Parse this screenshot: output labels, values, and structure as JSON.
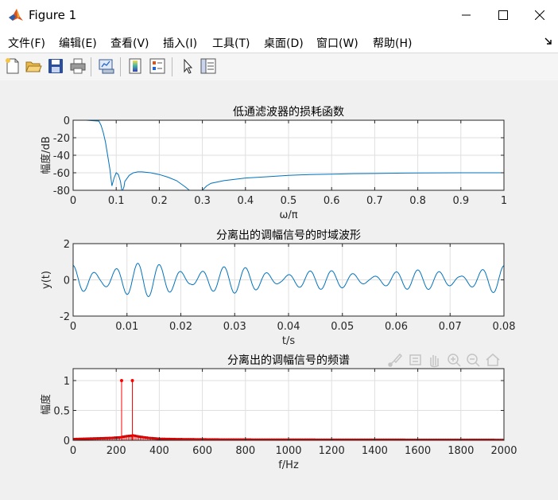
{
  "window": {
    "title": "Figure 1"
  },
  "menu": [
    {
      "label": "文件(F)"
    },
    {
      "label": "编辑(E)"
    },
    {
      "label": "查看(V)"
    },
    {
      "label": "插入(I)"
    },
    {
      "label": "工具(T)"
    },
    {
      "label": "桌面(D)"
    },
    {
      "label": "窗口(W)"
    },
    {
      "label": "帮助(H)"
    }
  ],
  "toolbar_icons": [
    "new-figure-icon",
    "open-file-icon",
    "save-icon",
    "print-icon",
    "link-plot-icon",
    "insert-colorbar-icon",
    "insert-legend-icon",
    "pointer-icon",
    "property-inspector-icon"
  ],
  "colors": {
    "line": "#0072bd",
    "stem": "#ff0000",
    "marker": "#a00000"
  },
  "chart_data": [
    {
      "type": "line",
      "title": "低通滤波器的损耗函数",
      "xlabel": "ω/π",
      "ylabel": "幅度/dB",
      "xlim": [
        0,
        1
      ],
      "ylim": [
        -80,
        0
      ],
      "xticks": [
        0,
        0.1,
        0.2,
        0.3,
        0.4,
        0.5,
        0.6,
        0.7,
        0.8,
        0.9,
        1
      ],
      "xtick_labels": [
        "0",
        "0.1",
        "0.2",
        "0.3",
        "0.4",
        "0.5",
        "0.6",
        "0.7",
        "0.8",
        "0.9",
        "1"
      ],
      "yticks": [
        0,
        -20,
        -40,
        -60,
        -80
      ],
      "ytick_labels": [
        "0",
        "-20",
        "-40",
        "-60",
        "-80"
      ],
      "grid": true,
      "x": [
        0,
        0.03,
        0.06,
        0.065,
        0.07,
        0.075,
        0.08,
        0.085,
        0.09,
        0.095,
        0.1,
        0.105,
        0.11,
        0.113,
        0.115,
        0.118,
        0.12,
        0.13,
        0.14,
        0.15,
        0.16,
        0.18,
        0.2,
        0.22,
        0.24,
        0.26,
        0.27,
        0.28,
        0.29,
        0.3,
        0.31,
        0.32,
        0.35,
        0.4,
        0.45,
        0.5,
        0.55,
        0.6,
        0.65,
        0.7,
        0.75,
        0.8,
        0.85,
        0.9,
        0.95,
        1.0
      ],
      "y": [
        0,
        0,
        -1,
        -6,
        -14,
        -25,
        -40,
        -55,
        -75,
        -66,
        -60,
        -62,
        -70,
        -80,
        -80,
        -76,
        -70,
        -63,
        -60,
        -59,
        -59,
        -60,
        -62,
        -65,
        -69,
        -76,
        -80,
        -80,
        -80,
        -80,
        -75,
        -72,
        -69,
        -66,
        -64.5,
        -63,
        -62,
        -61.5,
        -61,
        -60.8,
        -60.5,
        -60.3,
        -60.1,
        -60,
        -60,
        -60
      ]
    },
    {
      "type": "line",
      "title": "分离出的调幅信号的时域波形",
      "xlabel": "t/s",
      "ylabel": "y(t)",
      "xlim": [
        0,
        0.08
      ],
      "ylim": [
        -2,
        2
      ],
      "xticks": [
        0,
        0.01,
        0.02,
        0.03,
        0.04,
        0.05,
        0.06,
        0.07,
        0.08
      ],
      "xtick_labels": [
        "0",
        "0.01",
        "0.02",
        "0.03",
        "0.04",
        "0.05",
        "0.06",
        "0.07",
        "0.08"
      ],
      "yticks": [
        2,
        0,
        -2
      ],
      "ytick_labels": [
        "2",
        "0",
        "-2"
      ],
      "grid": true,
      "signal": {
        "carrier_hz": 250,
        "modulation_hz": 25,
        "amplitude": 0.72,
        "samples": 800
      }
    },
    {
      "type": "stem",
      "title": "分离出的调幅信号的频谱",
      "xlabel": "f/Hz",
      "ylabel": "幅度",
      "xlim": [
        0,
        2000
      ],
      "ylim": [
        0,
        1.2
      ],
      "xticks": [
        0,
        200,
        400,
        600,
        800,
        1000,
        1200,
        1400,
        1600,
        1800,
        2000
      ],
      "xtick_labels": [
        "0",
        "200",
        "400",
        "600",
        "800",
        "1000",
        "1200",
        "1400",
        "1600",
        "1800",
        "2000"
      ],
      "yticks": [
        0,
        0.5,
        1
      ],
      "ytick_labels": [
        "0",
        "0.5",
        "1"
      ],
      "grid": true,
      "peaks": [
        {
          "f": 225,
          "value": 1
        },
        {
          "f": 275,
          "value": 1
        }
      ],
      "baseline": [
        [
          0,
          0.02
        ],
        [
          100,
          0.03
        ],
        [
          180,
          0.04
        ],
        [
          220,
          0.05
        ],
        [
          250,
          0.07
        ],
        [
          280,
          0.08
        ],
        [
          310,
          0.06
        ],
        [
          350,
          0.04
        ],
        [
          400,
          0.025
        ],
        [
          500,
          0.018
        ],
        [
          700,
          0.012
        ],
        [
          1000,
          0.01
        ],
        [
          1500,
          0.008
        ],
        [
          2000,
          0.006
        ]
      ]
    }
  ]
}
